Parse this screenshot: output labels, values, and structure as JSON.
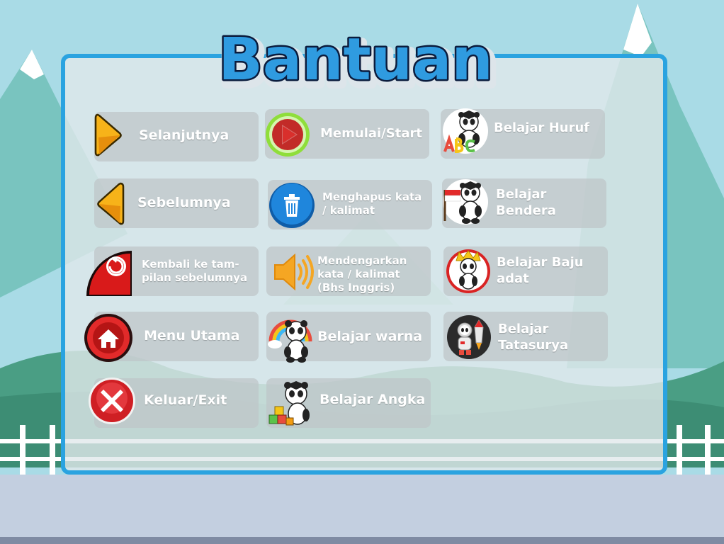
{
  "title": "Bantuan",
  "colors": {
    "panel_border": "#2aa3e0",
    "title_fill": "#2f9be0",
    "title_stroke": "#0b1c3d",
    "card_bg": "rgba(190,197,200,0.72)"
  },
  "items": {
    "next": {
      "label": "Selanjutnya",
      "icon": "orange-right-arrow-icon"
    },
    "prev": {
      "label": "Sebelumnya",
      "icon": "orange-left-arrow-icon"
    },
    "back": {
      "label": "Kembali ke tam-\npilan sebelumnya",
      "icon": "back-undo-icon"
    },
    "menu": {
      "label": "Menu Utama",
      "icon": "home-icon"
    },
    "exit": {
      "label": "Keluar/Exit",
      "icon": "close-x-icon"
    },
    "start": {
      "label": "Memulai/Start",
      "icon": "play-icon"
    },
    "delete": {
      "label": "Menghapus kata\n/ kalimat",
      "icon": "trash-icon"
    },
    "listen": {
      "label": "Mendengarkan\nkata / kalimat\n(Bhs Inggris)",
      "icon": "speaker-icon"
    },
    "warna": {
      "label": "Belajar warna",
      "icon": "panda-rainbow-icon"
    },
    "angka": {
      "label": "Belajar Angka",
      "icon": "panda-number-blocks-icon"
    },
    "huruf": {
      "label": "Belajar Huruf",
      "icon": "panda-abc-icon"
    },
    "bendera": {
      "label": "Belajar\nBendera",
      "icon": "panda-flag-icon"
    },
    "baju": {
      "label": "Belajar Baju\nadat",
      "icon": "panda-costume-icon"
    },
    "tatasurya": {
      "label": "Belajar\nTatasurya",
      "icon": "panda-rocket-icon"
    }
  }
}
